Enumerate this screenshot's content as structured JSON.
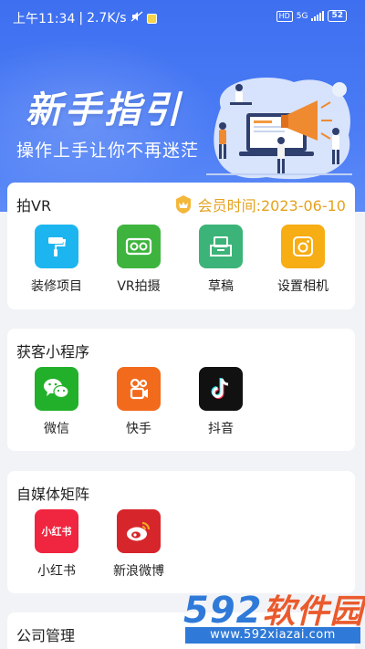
{
  "status_bar": {
    "time": "上午11:34",
    "speed": "2.7K/s",
    "hd": "HD",
    "net": "5G",
    "battery": "52"
  },
  "hero": {
    "title": "新手指引",
    "subtitle": "操作上手让你不再迷茫"
  },
  "sections": {
    "vr": {
      "title": "拍VR",
      "member_text": "会员时间:2023-06-10",
      "items": [
        {
          "label": "装修项目",
          "icon": "paint-roller-icon",
          "color": "#1cb5f0"
        },
        {
          "label": "VR拍摄",
          "icon": "vr-glasses-icon",
          "color": "#3eb43e"
        },
        {
          "label": "草稿",
          "icon": "draft-box-icon",
          "color": "#3cb378"
        },
        {
          "label": "设置相机",
          "icon": "camera-icon",
          "color": "#f7ad14"
        }
      ]
    },
    "mini": {
      "title": "获客小程序",
      "items": [
        {
          "label": "微信",
          "icon": "wechat-icon",
          "color": "#22b02a"
        },
        {
          "label": "快手",
          "icon": "kuaishou-icon",
          "color": "#f26a1b"
        },
        {
          "label": "抖音",
          "icon": "douyin-icon",
          "color": "#111111"
        }
      ]
    },
    "media": {
      "title": "自媒体矩阵",
      "items": [
        {
          "label": "小红书",
          "icon": "xiaohongshu-icon",
          "color": "#f0253f",
          "icon_text": "小红书"
        },
        {
          "label": "新浪微博",
          "icon": "weibo-icon",
          "color": "#d6252b"
        }
      ]
    },
    "company": {
      "title": "公司管理"
    }
  },
  "watermark": {
    "brand_num": "592",
    "brand_cn": "软件园",
    "url": "www.592xiazai.com"
  }
}
